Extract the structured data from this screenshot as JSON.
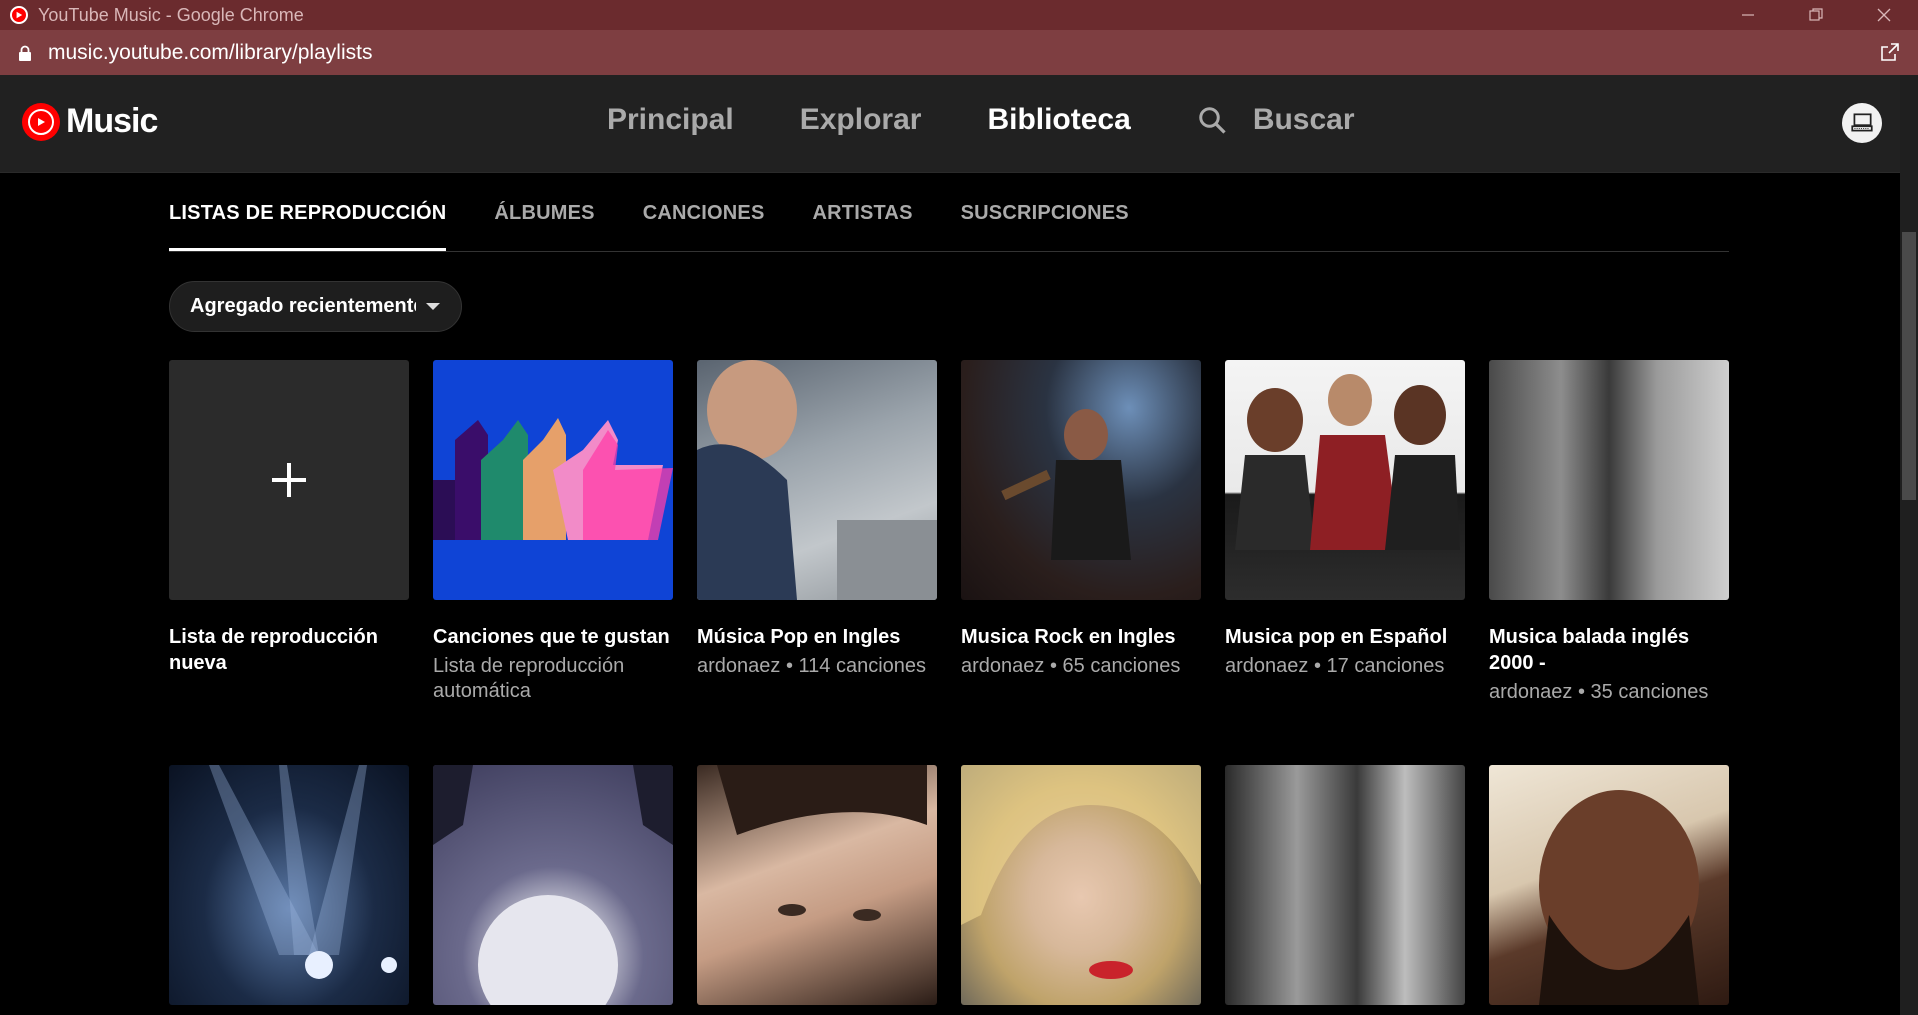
{
  "window": {
    "title": "YouTube Music - Google Chrome",
    "url": "music.youtube.com/library/playlists"
  },
  "header": {
    "logo_text": "Music",
    "nav": [
      "Principal",
      "Explorar",
      "Biblioteca"
    ],
    "active_nav": "Biblioteca",
    "search_label": "Buscar"
  },
  "tabs": [
    {
      "label": "LISTAS DE REPRODUCCIÓN",
      "active": true
    },
    {
      "label": "ÁLBUMES",
      "active": false
    },
    {
      "label": "CANCIONES",
      "active": false
    },
    {
      "label": "ARTISTAS",
      "active": false
    },
    {
      "label": "SUSCRIPCIONES",
      "active": false
    }
  ],
  "sort": {
    "label": "Agregado recientemente"
  },
  "playlists": [
    {
      "title": "Lista de reproducción nueva",
      "subtitle": ""
    },
    {
      "title": "Canciones que te gustan",
      "subtitle": "Lista de reproducción automática"
    },
    {
      "title": "Música Pop en Ingles",
      "subtitle": "ardonaez • 114 canciones"
    },
    {
      "title": "Musica Rock en Ingles",
      "subtitle": "ardonaez • 65 canciones"
    },
    {
      "title": "Musica pop en Español",
      "subtitle": "ardonaez • 17 canciones"
    },
    {
      "title": "Musica balada inglés 2000 -",
      "subtitle": "ardonaez • 35 canciones"
    }
  ],
  "colors": {
    "accent": "#ff0000",
    "titlebar": "#6b2b2e",
    "header_bg": "#212121"
  },
  "icons": {
    "search": "search-icon",
    "add": "plus-icon",
    "avatar": "avatar-icon"
  }
}
